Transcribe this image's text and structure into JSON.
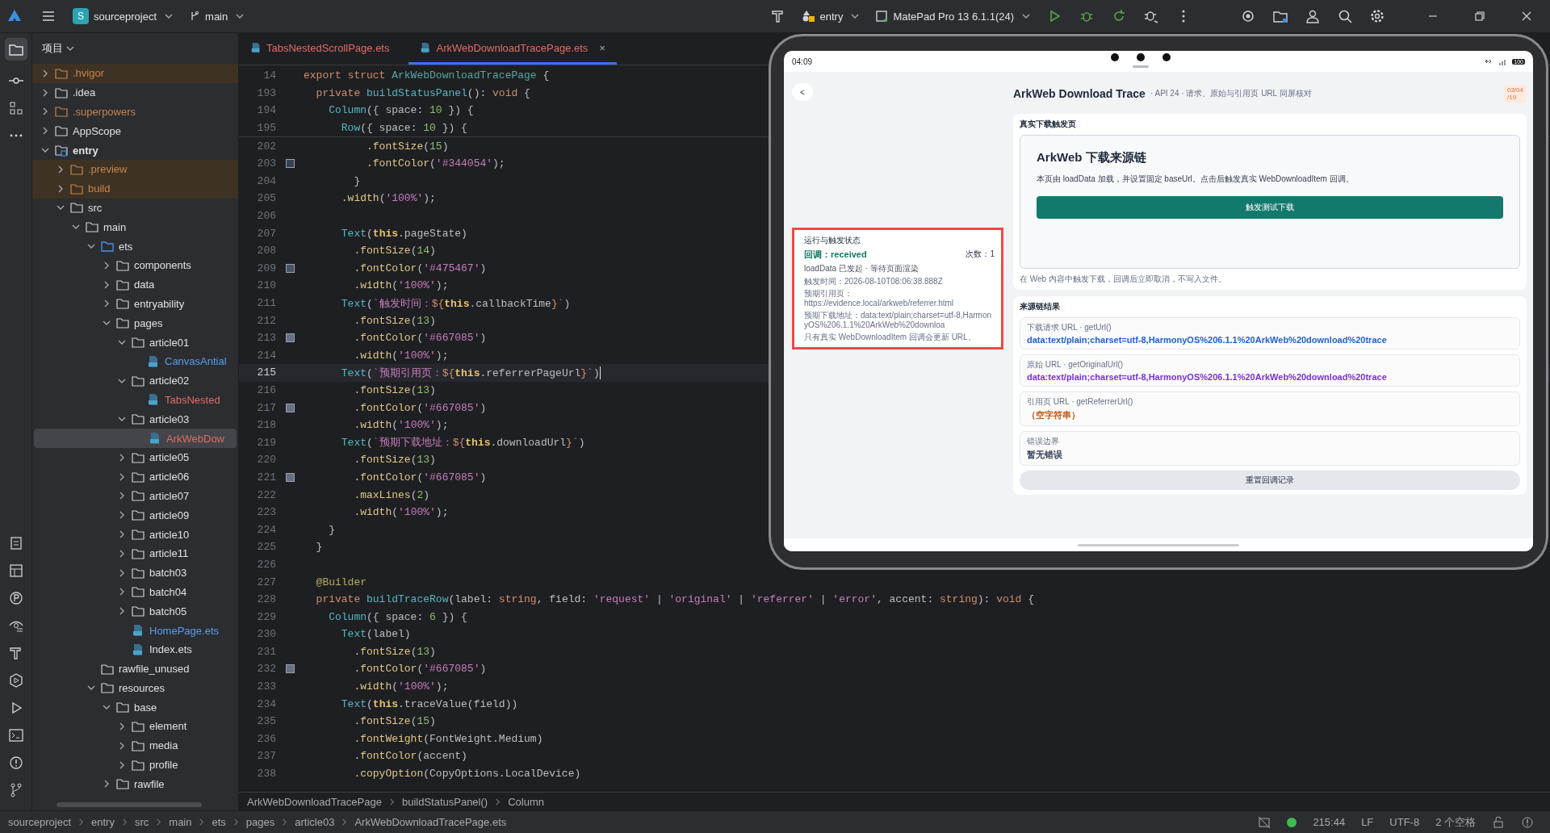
{
  "topbar": {
    "project_badge": "S",
    "project": "sourceproject",
    "branch": "main",
    "run_config": "entry",
    "device": "MatePad Pro 13 6.1.1(24)"
  },
  "project_panel": {
    "title": "项目"
  },
  "tree": [
    {
      "name": ".hvigor",
      "kind": "folder",
      "expanded": false,
      "color": "#c9844b",
      "excluded": true,
      "selected": false
    },
    {
      "name": ".idea",
      "kind": "folder",
      "expanded": false,
      "selected": false
    },
    {
      "name": ".superpowers",
      "kind": "folder",
      "expanded": false,
      "color": "#c9844b",
      "selected": false
    },
    {
      "name": "AppScope",
      "kind": "folder",
      "expanded": false,
      "selected": false
    },
    {
      "name": "entry",
      "kind": "module",
      "expanded": true,
      "selected": false,
      "children": [
        {
          "name": ".preview",
          "kind": "folder",
          "expanded": false,
          "color": "#c9844b",
          "excluded": true,
          "selected": false
        },
        {
          "name": "build",
          "kind": "folder",
          "expanded": false,
          "color": "#c9844b",
          "excluded": true,
          "selected": false
        },
        {
          "name": "src",
          "kind": "folder",
          "expanded": true,
          "selected": false,
          "children": [
            {
              "name": "main",
              "kind": "folder",
              "expanded": true,
              "selected": false,
              "children": [
                {
                  "name": "ets",
                  "kind": "source_folder",
                  "expanded": true,
                  "selected": false,
                  "children": [
                    {
                      "name": "components",
                      "kind": "folder",
                      "expanded": false,
                      "selected": false
                    },
                    {
                      "name": "data",
                      "kind": "folder",
                      "expanded": false,
                      "selected": false
                    },
                    {
                      "name": "entryability",
                      "kind": "folder",
                      "expanded": false,
                      "selected": false
                    },
                    {
                      "name": "pages",
                      "kind": "folder",
                      "expanded": true,
                      "selected": false,
                      "children": [
                        {
                          "name": "article01",
                          "kind": "folder",
                          "expanded": true,
                          "selected": false,
                          "children": [
                            {
                              "name": "CanvasAntial",
                              "kind": "file",
                              "color": "#5a9cf0",
                              "selected": false
                            }
                          ]
                        },
                        {
                          "name": "article02",
                          "kind": "folder",
                          "expanded": true,
                          "selected": false,
                          "children": [
                            {
                              "name": "TabsNested",
                              "kind": "file",
                              "color": "#e06c64",
                              "selected": false
                            }
                          ]
                        },
                        {
                          "name": "article03",
                          "kind": "folder",
                          "expanded": true,
                          "selected": false,
                          "children": [
                            {
                              "name": "ArkWebDow",
                              "kind": "file",
                              "color": "#e06c64",
                              "selected": true
                            }
                          ]
                        },
                        {
                          "name": "article05",
                          "kind": "folder",
                          "expanded": false,
                          "selected": false
                        },
                        {
                          "name": "article06",
                          "kind": "folder",
                          "expanded": false,
                          "selected": false
                        },
                        {
                          "name": "article07",
                          "kind": "folder",
                          "expanded": false,
                          "selected": false
                        },
                        {
                          "name": "article09",
                          "kind": "folder",
                          "expanded": false,
                          "selected": false
                        },
                        {
                          "name": "article10",
                          "kind": "folder",
                          "expanded": false,
                          "selected": false
                        },
                        {
                          "name": "article11",
                          "kind": "folder",
                          "expanded": false,
                          "selected": false
                        },
                        {
                          "name": "batch03",
                          "kind": "folder",
                          "expanded": false,
                          "selected": false
                        },
                        {
                          "name": "batch04",
                          "kind": "folder",
                          "expanded": false,
                          "selected": false
                        },
                        {
                          "name": "batch05",
                          "kind": "folder",
                          "expanded": false,
                          "selected": false
                        },
                        {
                          "name": "HomePage.ets",
                          "kind": "file",
                          "color": "#5a9cf0",
                          "selected": false
                        },
                        {
                          "name": "Index.ets",
                          "kind": "file",
                          "selected": false
                        }
                      ]
                    }
                  ]
                },
                {
                  "name": "rawfile_unused",
                  "kind": "folder",
                  "selected": false
                },
                {
                  "name": "resources",
                  "kind": "folder",
                  "expanded": true,
                  "selected": false,
                  "children": [
                    {
                      "name": "base",
                      "kind": "folder",
                      "expanded": true,
                      "selected": false,
                      "children": [
                        {
                          "name": "element",
                          "kind": "folder",
                          "expanded": false,
                          "selected": false
                        },
                        {
                          "name": "media",
                          "kind": "folder",
                          "expanded": false,
                          "selected": false
                        },
                        {
                          "name": "profile",
                          "kind": "folder",
                          "expanded": false,
                          "selected": false
                        }
                      ]
                    },
                    {
                      "name": "rawfile",
                      "kind": "folder",
                      "expanded": false,
                      "selected": false
                    }
                  ]
                }
              ]
            }
          ]
        }
      ]
    }
  ],
  "tabs": [
    {
      "label": "TabsNestedScrollPage.ets",
      "selected": false
    },
    {
      "label": "ArkWebDownloadTracePage.ets",
      "selected": true,
      "close": "×"
    }
  ],
  "sticky_lines": [
    {
      "num": "14",
      "segments": [
        {
          "kind": "k",
          "text": "export struct "
        },
        {
          "kind": "t",
          "text": "ArkWebDownloadTracePage"
        },
        {
          "kind": "p",
          "text": " {"
        }
      ]
    },
    {
      "num": "193",
      "segments": [
        {
          "kind": "k",
          "text": "  private "
        },
        {
          "kind": "f",
          "text": "buildStatusPanel"
        },
        {
          "kind": "p",
          "text": "(): "
        },
        {
          "kind": "k",
          "text": "void"
        },
        {
          "kind": "p",
          "text": " {"
        }
      ]
    },
    {
      "num": "194",
      "segments": [
        {
          "kind": "f",
          "text": "    Column"
        },
        {
          "kind": "p",
          "text": "({ space: "
        },
        {
          "kind": "n",
          "text": "10"
        },
        {
          "kind": "p",
          "text": " }) {"
        }
      ]
    },
    {
      "num": "195",
      "segments": [
        {
          "kind": "f",
          "text": "      Row"
        },
        {
          "kind": "p",
          "text": "({ space: "
        },
        {
          "kind": "n",
          "text": "10"
        },
        {
          "kind": "p",
          "text": " }) {"
        }
      ]
    }
  ],
  "lines": [
    {
      "num": "202",
      "selected": false,
      "segments": [
        {
          "kind": "m",
          "text": "          .fontSize"
        },
        {
          "kind": "p",
          "text": "("
        },
        {
          "kind": "n",
          "text": "15"
        },
        {
          "kind": "p",
          "text": ")"
        }
      ]
    },
    {
      "num": "203",
      "selected": false,
      "color": "#344054",
      "segments": [
        {
          "kind": "m",
          "text": "          .fontColor"
        },
        {
          "kind": "p",
          "text": "("
        },
        {
          "kind": "s",
          "text": "'#344054'"
        },
        {
          "kind": "p",
          "text": ");"
        }
      ]
    },
    {
      "num": "204",
      "selected": false,
      "segments": [
        {
          "kind": "p",
          "text": "        }"
        }
      ]
    },
    {
      "num": "205",
      "selected": false,
      "segments": [
        {
          "kind": "m",
          "text": "      .width"
        },
        {
          "kind": "p",
          "text": "("
        },
        {
          "kind": "s",
          "text": "'100%'"
        },
        {
          "kind": "p",
          "text": ");"
        }
      ]
    },
    {
      "num": "206",
      "selected": false
    },
    {
      "num": "207",
      "selected": false,
      "segments": [
        {
          "kind": "f",
          "text": "      Text"
        },
        {
          "kind": "p",
          "text": "("
        },
        {
          "kind": "th",
          "text": "this"
        },
        {
          "kind": "p",
          "text": ".pageState)"
        }
      ]
    },
    {
      "num": "208",
      "selected": false,
      "segments": [
        {
          "kind": "m",
          "text": "        .fontSize"
        },
        {
          "kind": "p",
          "text": "("
        },
        {
          "kind": "n",
          "text": "14"
        },
        {
          "kind": "p",
          "text": ")"
        }
      ]
    },
    {
      "num": "209",
      "selected": false,
      "color": "#475467",
      "segments": [
        {
          "kind": "m",
          "text": "        .fontColor"
        },
        {
          "kind": "p",
          "text": "("
        },
        {
          "kind": "s",
          "text": "'#475467'"
        },
        {
          "kind": "p",
          "text": ")"
        }
      ]
    },
    {
      "num": "210",
      "selected": false,
      "segments": [
        {
          "kind": "m",
          "text": "        .width"
        },
        {
          "kind": "p",
          "text": "("
        },
        {
          "kind": "s",
          "text": "'100%'"
        },
        {
          "kind": "p",
          "text": ");"
        }
      ]
    },
    {
      "num": "211",
      "selected": false,
      "segments": [
        {
          "kind": "f",
          "text": "      Text"
        },
        {
          "kind": "p",
          "text": "("
        },
        {
          "kind": "s",
          "text": "`触发时间："
        },
        {
          "kind": "k",
          "text": "${"
        },
        {
          "kind": "th",
          "text": "this"
        },
        {
          "kind": "p",
          "text": ".callbackTime"
        },
        {
          "kind": "k",
          "text": "}"
        },
        {
          "kind": "s",
          "text": "`"
        },
        {
          "kind": "p",
          "text": ")"
        }
      ]
    },
    {
      "num": "212",
      "selected": false,
      "segments": [
        {
          "kind": "m",
          "text": "        .fontSize"
        },
        {
          "kind": "p",
          "text": "("
        },
        {
          "kind": "n",
          "text": "13"
        },
        {
          "kind": "p",
          "text": ")"
        }
      ]
    },
    {
      "num": "213",
      "selected": false,
      "color": "#667085",
      "segments": [
        {
          "kind": "m",
          "text": "        .fontColor"
        },
        {
          "kind": "p",
          "text": "("
        },
        {
          "kind": "s",
          "text": "'#667085'"
        },
        {
          "kind": "p",
          "text": ")"
        }
      ]
    },
    {
      "num": "214",
      "selected": false,
      "segments": [
        {
          "kind": "m",
          "text": "        .width"
        },
        {
          "kind": "p",
          "text": "("
        },
        {
          "kind": "s",
          "text": "'100%'"
        },
        {
          "kind": "p",
          "text": ");"
        }
      ]
    },
    {
      "num": "215",
      "selected": true,
      "segments": [
        {
          "kind": "f",
          "text": "      Text"
        },
        {
          "kind": "p",
          "text": "("
        },
        {
          "kind": "s",
          "text": "`预期引用页："
        },
        {
          "kind": "k",
          "text": "${"
        },
        {
          "kind": "th",
          "text": "this"
        },
        {
          "kind": "p",
          "text": ".referrerPageUrl"
        },
        {
          "kind": "k",
          "text": "}"
        },
        {
          "kind": "s",
          "text": "`"
        },
        {
          "kind": "p",
          "text": ")"
        }
      ]
    },
    {
      "num": "216",
      "selected": false,
      "segments": [
        {
          "kind": "m",
          "text": "        .fontSize"
        },
        {
          "kind": "p",
          "text": "("
        },
        {
          "kind": "n",
          "text": "13"
        },
        {
          "kind": "p",
          "text": ")"
        }
      ]
    },
    {
      "num": "217",
      "selected": false,
      "color": "#667085",
      "segments": [
        {
          "kind": "m",
          "text": "        .fontColor"
        },
        {
          "kind": "p",
          "text": "("
        },
        {
          "kind": "s",
          "text": "'#667085'"
        },
        {
          "kind": "p",
          "text": ")"
        }
      ]
    },
    {
      "num": "218",
      "selected": false,
      "segments": [
        {
          "kind": "m",
          "text": "        .width"
        },
        {
          "kind": "p",
          "text": "("
        },
        {
          "kind": "s",
          "text": "'100%'"
        },
        {
          "kind": "p",
          "text": ");"
        }
      ]
    },
    {
      "num": "219",
      "selected": false,
      "segments": [
        {
          "kind": "f",
          "text": "      Text"
        },
        {
          "kind": "p",
          "text": "("
        },
        {
          "kind": "s",
          "text": "`预期下载地址："
        },
        {
          "kind": "k",
          "text": "${"
        },
        {
          "kind": "th",
          "text": "this"
        },
        {
          "kind": "p",
          "text": ".downloadUrl"
        },
        {
          "kind": "k",
          "text": "}"
        },
        {
          "kind": "s",
          "text": "`"
        },
        {
          "kind": "p",
          "text": ")"
        }
      ]
    },
    {
      "num": "220",
      "selected": false,
      "segments": [
        {
          "kind": "m",
          "text": "        .fontSize"
        },
        {
          "kind": "p",
          "text": "("
        },
        {
          "kind": "n",
          "text": "13"
        },
        {
          "kind": "p",
          "text": ")"
        }
      ]
    },
    {
      "num": "221",
      "selected": false,
      "color": "#667085",
      "segments": [
        {
          "kind": "m",
          "text": "        .fontColor"
        },
        {
          "kind": "p",
          "text": "("
        },
        {
          "kind": "s",
          "text": "'#667085'"
        },
        {
          "kind": "p",
          "text": ")"
        }
      ]
    },
    {
      "num": "222",
      "selected": false,
      "segments": [
        {
          "kind": "m",
          "text": "        .maxLines"
        },
        {
          "kind": "p",
          "text": "("
        },
        {
          "kind": "n",
          "text": "2"
        },
        {
          "kind": "p",
          "text": ")"
        }
      ]
    },
    {
      "num": "223",
      "selected": false,
      "segments": [
        {
          "kind": "m",
          "text": "        .width"
        },
        {
          "kind": "p",
          "text": "("
        },
        {
          "kind": "s",
          "text": "'100%'"
        },
        {
          "kind": "p",
          "text": ");"
        }
      ]
    },
    {
      "num": "224",
      "selected": false,
      "segments": [
        {
          "kind": "p",
          "text": "    }"
        }
      ]
    },
    {
      "num": "225",
      "selected": false,
      "segments": [
        {
          "kind": "p",
          "text": "  }"
        }
      ]
    },
    {
      "num": "226",
      "selected": false
    },
    {
      "num": "227",
      "selected": false,
      "segments": [
        {
          "kind": "d",
          "text": "  @Builder"
        }
      ]
    },
    {
      "num": "228",
      "selected": false,
      "segments": [
        {
          "kind": "k",
          "text": "  private "
        },
        {
          "kind": "f",
          "text": "buildTraceRow"
        },
        {
          "kind": "p",
          "text": "(label: "
        },
        {
          "kind": "k",
          "text": "string"
        },
        {
          "kind": "p",
          "text": ", field: "
        },
        {
          "kind": "s",
          "text": "'request'"
        },
        {
          "kind": "p",
          "text": " | "
        },
        {
          "kind": "s",
          "text": "'original'"
        },
        {
          "kind": "p",
          "text": " | "
        },
        {
          "kind": "s",
          "text": "'referrer'"
        },
        {
          "kind": "p",
          "text": " | "
        },
        {
          "kind": "s",
          "text": "'error'"
        },
        {
          "kind": "p",
          "text": ", accent: "
        },
        {
          "kind": "k",
          "text": "string"
        },
        {
          "kind": "p",
          "text": "): "
        },
        {
          "kind": "k",
          "text": "void"
        },
        {
          "kind": "p",
          "text": " {"
        }
      ]
    },
    {
      "num": "229",
      "selected": false,
      "segments": [
        {
          "kind": "f",
          "text": "    Column"
        },
        {
          "kind": "p",
          "text": "({ space: "
        },
        {
          "kind": "n",
          "text": "6"
        },
        {
          "kind": "p",
          "text": " }) {"
        }
      ]
    },
    {
      "num": "230",
      "selected": false,
      "segments": [
        {
          "kind": "f",
          "text": "      Text"
        },
        {
          "kind": "p",
          "text": "(label)"
        }
      ]
    },
    {
      "num": "231",
      "selected": false,
      "segments": [
        {
          "kind": "m",
          "text": "        .fontSize"
        },
        {
          "kind": "p",
          "text": "("
        },
        {
          "kind": "n",
          "text": "13"
        },
        {
          "kind": "p",
          "text": ")"
        }
      ]
    },
    {
      "num": "232",
      "selected": false,
      "color": "#667085",
      "segments": [
        {
          "kind": "m",
          "text": "        .fontColor"
        },
        {
          "kind": "p",
          "text": "("
        },
        {
          "kind": "s",
          "text": "'#667085'"
        },
        {
          "kind": "p",
          "text": ")"
        }
      ]
    },
    {
      "num": "233",
      "selected": false,
      "segments": [
        {
          "kind": "m",
          "text": "        .width"
        },
        {
          "kind": "p",
          "text": "("
        },
        {
          "kind": "s",
          "text": "'100%'"
        },
        {
          "kind": "p",
          "text": ");"
        }
      ]
    },
    {
      "num": "234",
      "selected": false,
      "segments": [
        {
          "kind": "f",
          "text": "      Text"
        },
        {
          "kind": "p",
          "text": "("
        },
        {
          "kind": "th",
          "text": "this"
        },
        {
          "kind": "p",
          "text": ".traceValue(field))"
        }
      ]
    },
    {
      "num": "235",
      "selected": false,
      "segments": [
        {
          "kind": "m",
          "text": "        .fontSize"
        },
        {
          "kind": "p",
          "text": "("
        },
        {
          "kind": "n",
          "text": "15"
        },
        {
          "kind": "p",
          "text": ")"
        }
      ]
    },
    {
      "num": "236",
      "selected": false,
      "segments": [
        {
          "kind": "m",
          "text": "        .fontWeight"
        },
        {
          "kind": "p",
          "text": "(FontWeight.Medium)"
        }
      ]
    },
    {
      "num": "237",
      "selected": false,
      "segments": [
        {
          "kind": "m",
          "text": "        .fontColor"
        },
        {
          "kind": "p",
          "text": "(accent)"
        }
      ]
    },
    {
      "num": "238",
      "selected": false,
      "segments": [
        {
          "kind": "m",
          "text": "        .copyOption"
        },
        {
          "kind": "p",
          "text": "(CopyOptions.LocalDevice)"
        }
      ]
    }
  ],
  "breadcrumb": [
    "ArkWebDownloadTracePage",
    "buildStatusPanel()",
    "Column"
  ],
  "device": {
    "time": "04:09",
    "battery": "100",
    "back": "<",
    "title": "ArkWeb Download Trace",
    "subtitle": "· API 24 · 请求、原始与引用页 URL 同屏核对",
    "date_badge": [
      "03/04",
      "/19"
    ],
    "status_panel": {
      "title": "运行与触发状态",
      "callback": "回调：received",
      "count": "次数：1",
      "state": "loadData 已发起 · 等待页面渲染",
      "time": "触发时间：2026-08-10T08:06:38.888Z",
      "referrer": "预期引用页：https://evidence.local/arkweb/referrer.html",
      "download": "预期下载地址：data:text/plain;charset=utf-8,HarmonyOS%206.1.1%20ArkWeb%20downloa",
      "note": "只有真实 WebDownloadItem 回调会更新 URL。",
      "highlighted": true
    },
    "trigger_card": {
      "title": "真实下载触发页",
      "web_title": "ArkWeb 下载来源链",
      "web_text": "本页由 loadData 加载，并设置固定 baseUrl。点击后触发真实 WebDownloadItem 回调。",
      "button": "触发测试下载",
      "note": "在 Web 内容中触发下载，回调后立即取消，不写入文件。"
    },
    "result_card": {
      "title": "来源链结果",
      "rows": [
        {
          "label": "下载请求 URL · getUrl()",
          "value": "data:text/plain;charset=utf-8,HarmonyOS%206.1.1%20ArkWeb%20download%20trace",
          "color": "#1f5fd6"
        },
        {
          "label": "原始 URL · getOriginalUrl()",
          "value": "data:text/plain;charset=utf-8,HarmonyOS%206.1.1%20ArkWeb%20download%20trace",
          "color": "#7b2fd6"
        },
        {
          "label": "引用页 URL · getReferrerUrl()",
          "value": "（空字符串）",
          "color": "#c2530f"
        },
        {
          "label": "错误边界",
          "value": "暂无错误",
          "color": "#344054"
        }
      ],
      "button": "重置回调记录"
    }
  },
  "status_bar": {
    "path": [
      "sourceproject",
      "entry",
      "src",
      "main",
      "ets",
      "pages",
      "article03",
      "ArkWebDownloadTracePage.ets"
    ],
    "position": "215:44",
    "line_ending": "LF",
    "encoding": "UTF-8",
    "indent": "2 个空格"
  }
}
